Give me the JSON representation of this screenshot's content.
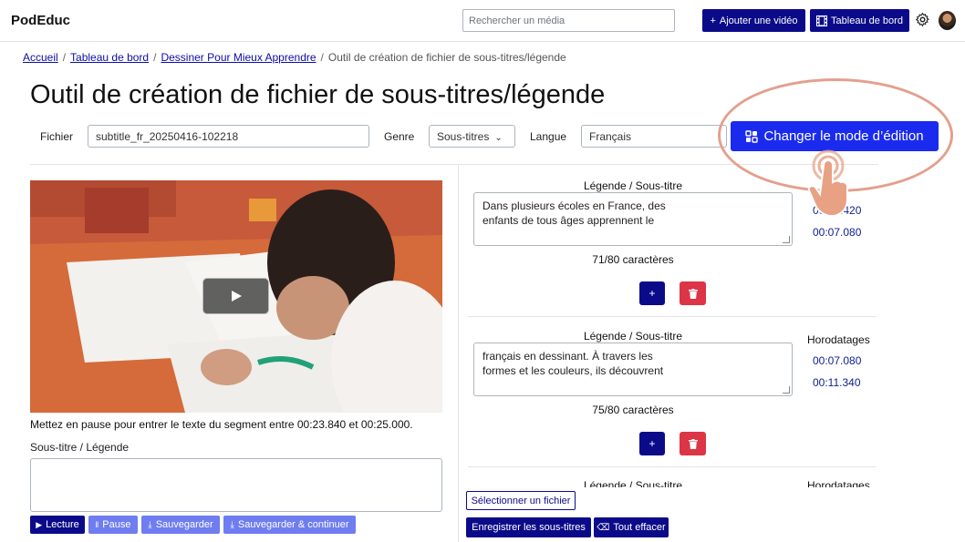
{
  "header": {
    "brand": "PodEduc",
    "search_placeholder": "Rechercher un média",
    "add_video_label": "Ajouter une vidéo",
    "dashboard_label": "Tableau de bord"
  },
  "breadcrumb": {
    "items": [
      "Accueil",
      "Tableau de bord",
      "Dessiner Pour Mieux Apprendre"
    ],
    "current": "Outil de création de fichier de sous-titres/légende"
  },
  "page_title": "Outil de création de fichier de sous-titres/légende",
  "form": {
    "file_label": "Fichier",
    "file_value": "subtitle_fr_20250416-102218",
    "genre_label": "Genre",
    "genre_value": "Sous-titres",
    "language_label": "Langue",
    "language_value": "Français",
    "mode_button": "Changer le mode d’édition"
  },
  "player": {
    "pause_note": "Mettez en pause pour entrer le texte du segment entre 00:23.840 et 00:25.000.",
    "subtitle_label": "Sous-titre / Légende",
    "subtitle_value": "",
    "controls": {
      "play": "Lecture",
      "pause": "Pause",
      "save": "Sauvegarder",
      "save_continue": "Sauvegarder & continuer"
    }
  },
  "segments": [
    {
      "title": "Légende / Sous-titre",
      "text_line1": "Dans plusieurs écoles en France, des",
      "text_line2": "enfants de tous âges apprennent le",
      "count": "71/80 caractères",
      "timestamp_label": "",
      "start": "00:03.420",
      "end": "00:07.080"
    },
    {
      "title": "Légende / Sous-titre",
      "text_line1": "français en dessinant. À travers les",
      "text_line2": "formes et les couleurs, ils découvrent",
      "count": "75/80 caractères",
      "timestamp_label": "Horodatages",
      "start": "00:07.080",
      "end": "00:11.340"
    },
    {
      "title": "Légende / Sous-titre",
      "timestamp_label": "Horodatages"
    }
  ],
  "segment_buttons": {
    "add": "+"
  },
  "footer_actions": {
    "select_file": "Sélectionner un fichier",
    "save_subtitles": "Enregistrer les sous-titres",
    "clear_all": "Tout effacer"
  },
  "colors": {
    "primary": "#0b0b8a",
    "mode_button": "#1a2bef",
    "danger": "#dc3545",
    "highlight_oval": "#e3a08e",
    "control_light": "#6f7df0"
  }
}
